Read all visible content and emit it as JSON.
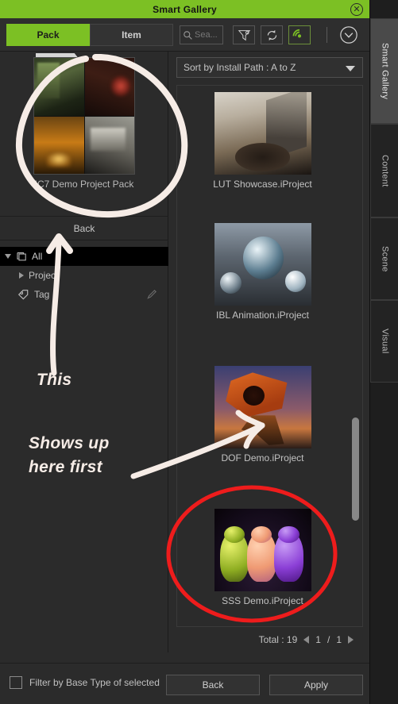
{
  "window": {
    "title": "Smart Gallery",
    "close_icon": "circle-x-icon"
  },
  "dock_tabs": [
    {
      "label": "Smart Gallery",
      "active": true
    },
    {
      "label": "Content",
      "active": false
    },
    {
      "label": "Scene",
      "active": false
    },
    {
      "label": "Visual",
      "active": false
    }
  ],
  "toolbar": {
    "tabs": [
      {
        "label": "Pack",
        "active": true
      },
      {
        "label": "Item",
        "active": false
      }
    ],
    "search_placeholder": "Sea...",
    "search_value": "",
    "icons": [
      "search-icon",
      "filter-settings-icon",
      "refresh-icon",
      "radar-icon",
      "chevron-down-circle-icon"
    ]
  },
  "left_panel": {
    "pack": {
      "name": "IC7 Demo Project Pack",
      "thumb_colors": [
        "#53633a",
        "#3d1d14",
        "#c87b16",
        "#6d6b63"
      ]
    },
    "back_label": "Back",
    "tree": [
      {
        "label": "All",
        "icon": "layers-icon",
        "selected": true,
        "expander": "down"
      },
      {
        "label": "Project",
        "icon": "",
        "selected": false,
        "expander": "right"
      },
      {
        "label": "Tag",
        "icon": "tag-icon",
        "selected": false,
        "expander": "none",
        "edit_icon": "pencil-icon"
      }
    ]
  },
  "right_panel": {
    "sort_label": "Sort by Install Path : A to Z",
    "items": [
      {
        "label": "LUT Showcase.iProject",
        "thumb": "interior-lounge-stairs"
      },
      {
        "label": "IBL Animation.iProject",
        "thumb": "chrome-spheres-street"
      },
      {
        "label": "DOF Demo.iProject",
        "thumb": "orange-mech-robot"
      },
      {
        "label": "SSS Demo.iProject",
        "thumb": "three-gummy-bears"
      }
    ],
    "pagination": {
      "total_label": "Total : 19",
      "current_page": "1",
      "separator": "/",
      "total_pages": "1",
      "prev_icon": "triangle-left-icon",
      "next_icon": "triangle-right-icon"
    }
  },
  "bottom_bar": {
    "checkbox_label": "Filter by Base Type of selected i",
    "checkbox_checked": false,
    "back_label": "Back",
    "apply_label": "Apply"
  },
  "annotations": {
    "text_1": "This",
    "text_2_line1": "Shows up",
    "text_2_line2": "here first",
    "white_color": "#f6ece6",
    "red_color": "#ee1c1c"
  }
}
